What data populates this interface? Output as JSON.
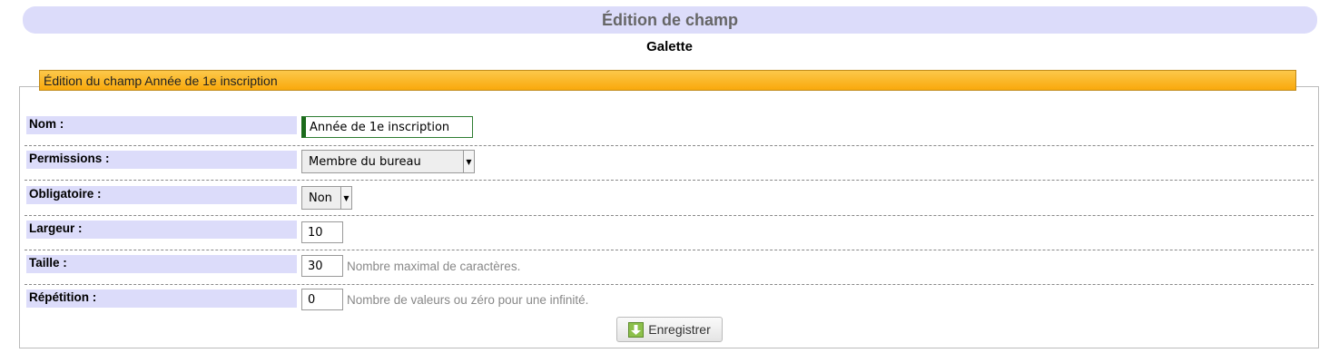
{
  "header": {
    "title": "Édition de champ"
  },
  "subtitle": "Galette",
  "panel": {
    "legend": "Édition du champ Année de 1e inscription"
  },
  "form": {
    "nom": {
      "label": "Nom :",
      "value": "Année de 1e inscription"
    },
    "permissions": {
      "label": "Permissions :",
      "value": "Membre du bureau"
    },
    "obligatoire": {
      "label": "Obligatoire :",
      "value": "Non"
    },
    "largeur": {
      "label": "Largeur :",
      "value": "10"
    },
    "taille": {
      "label": "Taille :",
      "value": "30",
      "hint": "Nombre maximal de caractères."
    },
    "repetition": {
      "label": "Répétition :",
      "value": "0",
      "hint": "Nombre de valeurs ou zéro pour une infinité."
    }
  },
  "actions": {
    "save_label": "Enregistrer",
    "save_icon": "download-icon"
  },
  "colors": {
    "header_bg": "#dcdcfa",
    "label_bg": "#dcdcfa",
    "legend_bg": "#fbb829",
    "focus_border": "#1b6b1b"
  }
}
